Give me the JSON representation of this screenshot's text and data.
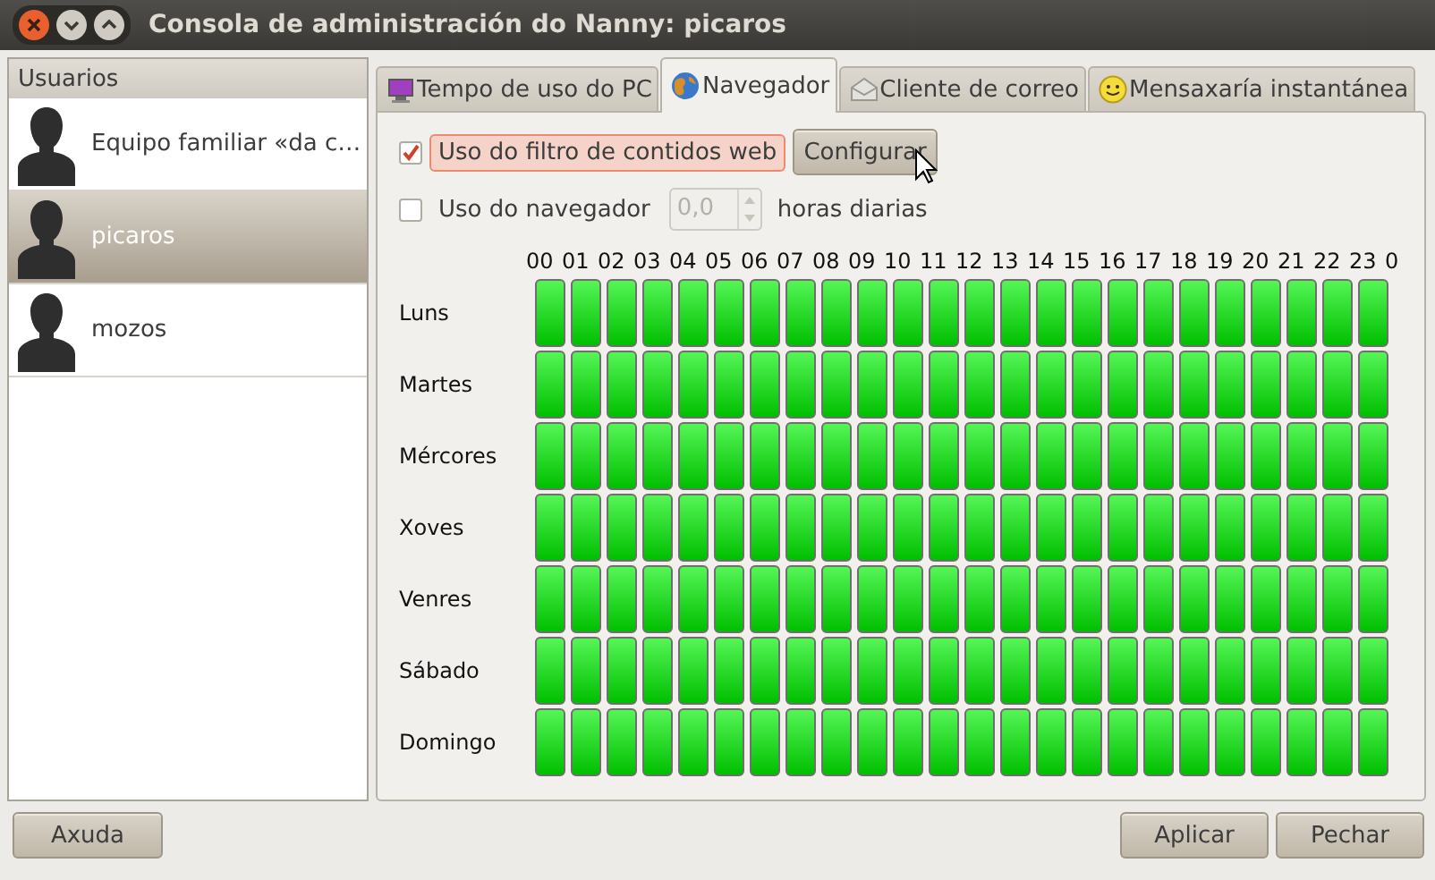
{
  "window": {
    "title": "Consola de administración do Nanny: picaros"
  },
  "users": {
    "header": "Usuarios",
    "items": [
      {
        "name": "Equipo familiar «da c…",
        "selected": false
      },
      {
        "name": "picaros",
        "selected": true
      },
      {
        "name": "mozos",
        "selected": false
      }
    ]
  },
  "tabs": [
    {
      "label": "Tempo de uso do PC",
      "selected": false
    },
    {
      "label": "Navegador",
      "selected": true
    },
    {
      "label": "Cliente de correo",
      "selected": false
    },
    {
      "label": "Mensaxaría instantánea",
      "selected": false
    }
  ],
  "filter": {
    "label": "Uso do filtro de contidos web",
    "checked": true,
    "highlighted": true,
    "button": "Configurar"
  },
  "limit": {
    "label": "Uso do navegador",
    "checked": false,
    "value": "0,0",
    "disabled": true,
    "unit": "horas diarias"
  },
  "schedule": {
    "hours": [
      "00",
      "01",
      "02",
      "03",
      "04",
      "05",
      "06",
      "07",
      "08",
      "09",
      "10",
      "11",
      "12",
      "13",
      "14",
      "15",
      "16",
      "17",
      "18",
      "19",
      "20",
      "21",
      "22",
      "23",
      "0"
    ],
    "days": [
      {
        "name": "Luns",
        "allowed": [
          true,
          true,
          true,
          true,
          true,
          true,
          true,
          true,
          true,
          true,
          true,
          true,
          true,
          true,
          true,
          true,
          true,
          true,
          true,
          true,
          true,
          true,
          true,
          true
        ]
      },
      {
        "name": "Martes",
        "allowed": [
          true,
          true,
          true,
          true,
          true,
          true,
          true,
          true,
          true,
          true,
          true,
          true,
          true,
          true,
          true,
          true,
          true,
          true,
          true,
          true,
          true,
          true,
          true,
          true
        ]
      },
      {
        "name": "Mércores",
        "allowed": [
          true,
          true,
          true,
          true,
          true,
          true,
          true,
          true,
          true,
          true,
          true,
          true,
          true,
          true,
          true,
          true,
          true,
          true,
          true,
          true,
          true,
          true,
          true,
          true
        ]
      },
      {
        "name": "Xoves",
        "allowed": [
          true,
          true,
          true,
          true,
          true,
          true,
          true,
          true,
          true,
          true,
          true,
          true,
          true,
          true,
          true,
          true,
          true,
          true,
          true,
          true,
          true,
          true,
          true,
          true
        ]
      },
      {
        "name": "Venres",
        "allowed": [
          true,
          true,
          true,
          true,
          true,
          true,
          true,
          true,
          true,
          true,
          true,
          true,
          true,
          true,
          true,
          true,
          true,
          true,
          true,
          true,
          true,
          true,
          true,
          true
        ]
      },
      {
        "name": "Sábado",
        "allowed": [
          true,
          true,
          true,
          true,
          true,
          true,
          true,
          true,
          true,
          true,
          true,
          true,
          true,
          true,
          true,
          true,
          true,
          true,
          true,
          true,
          true,
          true,
          true,
          true
        ]
      },
      {
        "name": "Domingo",
        "allowed": [
          true,
          true,
          true,
          true,
          true,
          true,
          true,
          true,
          true,
          true,
          true,
          true,
          true,
          true,
          true,
          true,
          true,
          true,
          true,
          true,
          true,
          true,
          true,
          true
        ]
      }
    ]
  },
  "buttons": {
    "help": "Axuda",
    "apply": "Aplicar",
    "close": "Pechar"
  }
}
